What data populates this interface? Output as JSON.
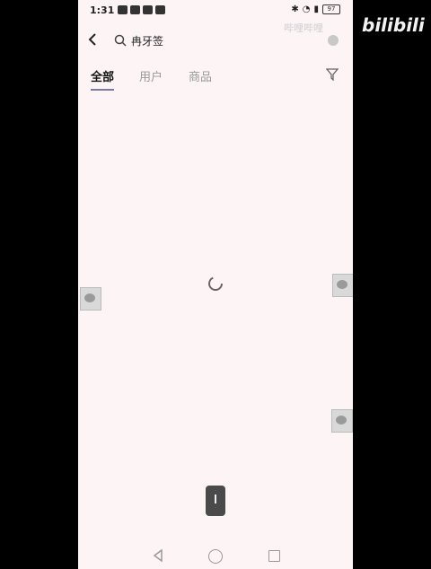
{
  "status_bar": {
    "time": "1:31",
    "battery": "97"
  },
  "search": {
    "query": "冉牙签"
  },
  "tabs": [
    {
      "label": "全部"
    },
    {
      "label": "用户"
    },
    {
      "label": "商品"
    }
  ],
  "watermark": {
    "text": "哔哩哔哩",
    "logo": "bilibili"
  },
  "colors": {
    "background": "#fdf4f6",
    "active_tab": "#111111",
    "inactive_tab": "#999999"
  }
}
